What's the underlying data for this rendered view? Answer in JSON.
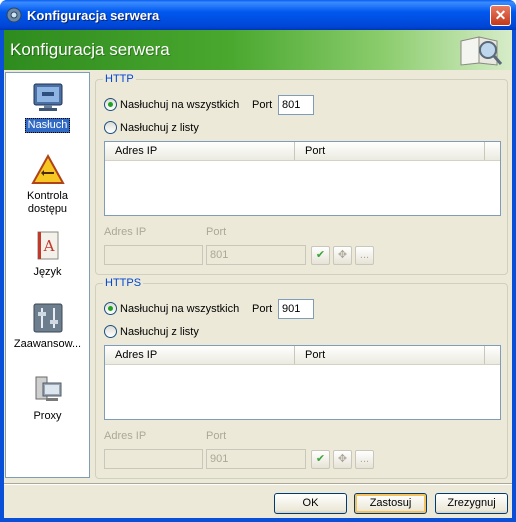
{
  "window": {
    "title": "Konfiguracja serwera",
    "close_glyph": "✕"
  },
  "banner": {
    "title": "Konfiguracja serwera",
    "icon": "book-magnifier-icon"
  },
  "sidebar": {
    "items": [
      {
        "label": "Nasłuch",
        "icon": "monitor-icon",
        "selected": true
      },
      {
        "label": "Kontrola dostępu",
        "label_line1": "Kontrola",
        "label_line2": "dostępu",
        "icon": "warning-triangle-icon"
      },
      {
        "label": "Język",
        "icon": "language-book-icon"
      },
      {
        "label": "Zaawansowane",
        "label_display": "Zaawansow...",
        "icon": "sliders-icon"
      },
      {
        "label": "Proxy",
        "icon": "computer-proxy-icon"
      }
    ]
  },
  "http": {
    "title": "HTTP",
    "listen_all": "Nasłuchuj na wszystkich",
    "listen_list": "Nasłuchuj z listy",
    "listen_mode": "all",
    "port_label": "Port",
    "port_value": "801",
    "col_ip": "Adres IP",
    "col_port": "Port",
    "rows": [],
    "new_ip_label": "Adres IP",
    "new_port_label": "Port",
    "new_ip_value": "",
    "new_port_value": "801",
    "btn_confirm": "✔",
    "btn_move": "✥",
    "btn_more": "..."
  },
  "https": {
    "title": "HTTPS",
    "listen_all": "Nasłuchuj na wszystkich",
    "listen_list": "Nasłuchuj z listy",
    "listen_mode": "all",
    "port_label": "Port",
    "port_value": "901",
    "col_ip": "Adres IP",
    "col_port": "Port",
    "rows": [],
    "new_ip_label": "Adres IP",
    "new_port_label": "Port",
    "new_ip_value": "",
    "new_port_value": "901",
    "btn_confirm": "✔",
    "btn_move": "✥",
    "btn_more": "..."
  },
  "buttons": {
    "ok": "OK",
    "apply": "Zastosuj",
    "cancel": "Zrezygnuj"
  },
  "colors": {
    "titlebar": "#0058ee",
    "banner_start": "#2e8b1e",
    "group_title": "#0046d5",
    "selection": "#316ac5"
  }
}
